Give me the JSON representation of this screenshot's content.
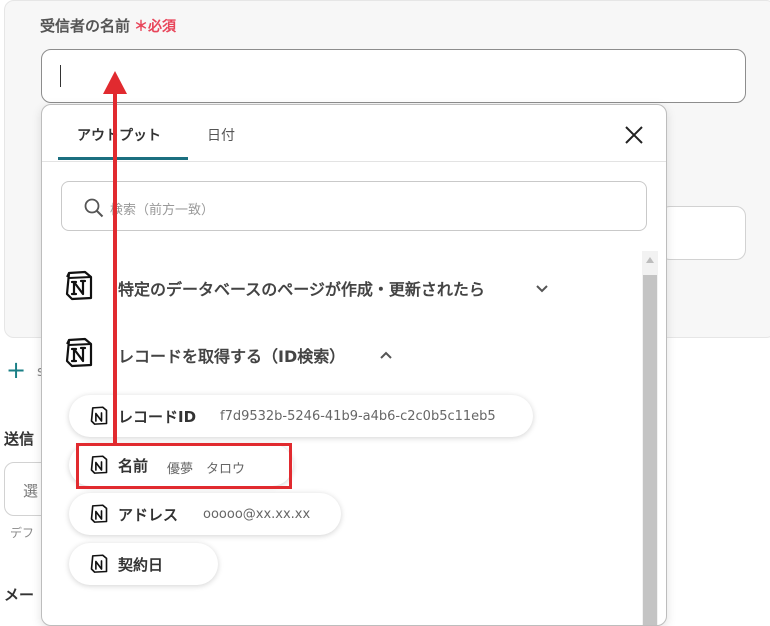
{
  "form": {
    "recipient_label": "受信者の名前",
    "required_mark": "＊",
    "required_text": "必須",
    "add_label": "十",
    "add_text": "s",
    "send_label": "送信",
    "select_placeholder": "選",
    "default_text": "デフ",
    "mail_label": "メー"
  },
  "dropdown": {
    "tabs": [
      {
        "label": "アウトプット",
        "active": true
      },
      {
        "label": "日付",
        "active": false
      }
    ],
    "search_placeholder": "検索（前方一致）",
    "sections": [
      {
        "title": "特定のデータベースのページが作成・更新されたら",
        "expanded": false
      },
      {
        "title": "レコードを取得する（ID検索）",
        "expanded": true
      }
    ],
    "chips": [
      {
        "label": "レコードID",
        "value": "f7d9532b-5246-41b9-a4b6-c2c0b5c11eb5"
      },
      {
        "label": "名前",
        "value": "優夢　タロウ"
      },
      {
        "label": "アドレス",
        "value": "ooooo@xx.xx.xx"
      },
      {
        "label": "契約日",
        "value": ""
      }
    ]
  },
  "colors": {
    "accent": "#1b6f80",
    "required": "#e8455a",
    "annotation": "#e12a2f"
  },
  "icons": [
    "notion-logo-icon",
    "search-icon",
    "close-icon",
    "chevron-down-icon",
    "chevron-up-icon",
    "plus-icon"
  ]
}
